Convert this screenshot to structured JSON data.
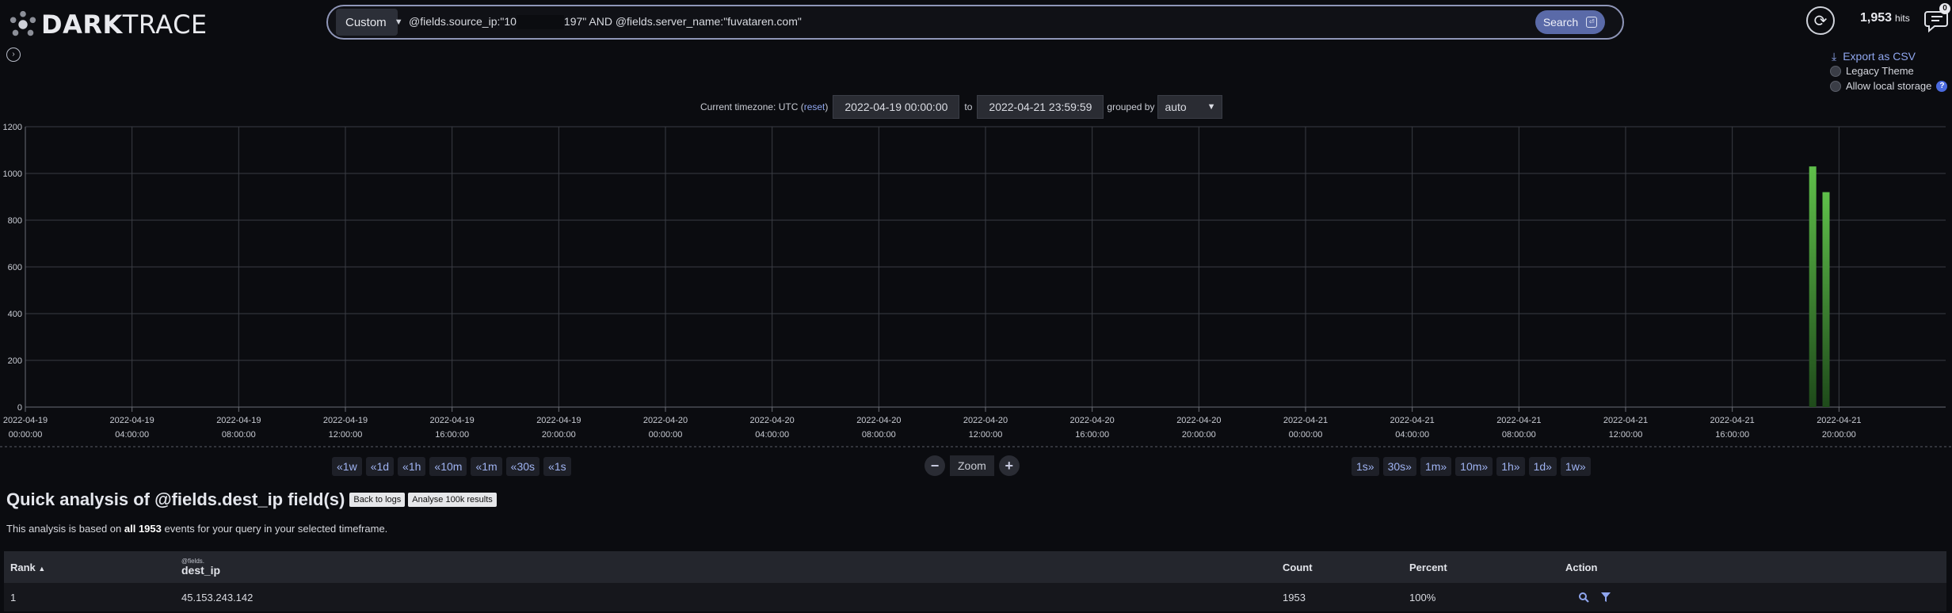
{
  "brand": {
    "name_bold": "DARK",
    "name_thin": "TRACE"
  },
  "search": {
    "type": "Custom",
    "query_prefix": "@fields.source_ip:\"10",
    "query_suffix": "197\" AND @fields.server_name:\"fuvataren.com\"",
    "button": "Search"
  },
  "hits": {
    "count": "1,953",
    "unit": "hits"
  },
  "notifications": {
    "badge": "0"
  },
  "options": {
    "export": "Export as CSV",
    "legacy_theme": "Legacy Theme",
    "allow_local_storage": "Allow local storage"
  },
  "timerange": {
    "tz_label": "Current timezone: UTC (",
    "tz_reset": "reset",
    "tz_close": ")",
    "from": "2022-04-19 00:00:00",
    "to_label": "to",
    "to": "2022-04-21 23:59:59",
    "grouped_label": "grouped by",
    "grouped_value": "auto"
  },
  "chart_data": {
    "type": "bar",
    "y_ticks": [
      0,
      200,
      400,
      600,
      800,
      1000,
      1200
    ],
    "ylim": [
      0,
      1200
    ],
    "x_start_hours": 0,
    "x_end_hours": 72,
    "x_ticks": [
      {
        "date": "2022-04-19",
        "time": "00:00:00"
      },
      {
        "date": "2022-04-19",
        "time": "04:00:00"
      },
      {
        "date": "2022-04-19",
        "time": "08:00:00"
      },
      {
        "date": "2022-04-19",
        "time": "12:00:00"
      },
      {
        "date": "2022-04-19",
        "time": "16:00:00"
      },
      {
        "date": "2022-04-19",
        "time": "20:00:00"
      },
      {
        "date": "2022-04-20",
        "time": "00:00:00"
      },
      {
        "date": "2022-04-20",
        "time": "04:00:00"
      },
      {
        "date": "2022-04-20",
        "time": "08:00:00"
      },
      {
        "date": "2022-04-20",
        "time": "12:00:00"
      },
      {
        "date": "2022-04-20",
        "time": "16:00:00"
      },
      {
        "date": "2022-04-20",
        "time": "20:00:00"
      },
      {
        "date": "2022-04-21",
        "time": "00:00:00"
      },
      {
        "date": "2022-04-21",
        "time": "04:00:00"
      },
      {
        "date": "2022-04-21",
        "time": "08:00:00"
      },
      {
        "date": "2022-04-21",
        "time": "12:00:00"
      },
      {
        "date": "2022-04-21",
        "time": "16:00:00"
      },
      {
        "date": "2022-04-21",
        "time": "20:00:00"
      }
    ],
    "bars": [
      {
        "x": "2022-04-21 19:00",
        "value": 1030
      },
      {
        "x": "2022-04-21 19:30",
        "value": 920
      }
    ],
    "bar_color": "#5fbf4a",
    "grid": true
  },
  "pager_back": [
    "1w",
    "1d",
    "1h",
    "10m",
    "1m",
    "30s",
    "1s"
  ],
  "pager_fwd": [
    "1s",
    "30s",
    "1m",
    "10m",
    "1h",
    "1d",
    "1w"
  ],
  "zoom_label": "Zoom",
  "analysis": {
    "title": "Quick analysis of @fields.dest_ip field(s)",
    "back_btn": "Back to logs",
    "analyse_btn": "Analyse 100k results",
    "desc_pre": "This analysis is based on",
    "desc_bold": "all 1953",
    "desc_post": "events for your query in your selected timeframe."
  },
  "table": {
    "headers": {
      "rank": "Rank",
      "ip_prefix": "@fields.",
      "ip": "dest_ip",
      "count": "Count",
      "percent": "Percent",
      "action": "Action"
    },
    "rows": [
      {
        "rank": "1",
        "ip": "45.153.243.142",
        "count": "1953",
        "percent": "100%"
      }
    ]
  }
}
